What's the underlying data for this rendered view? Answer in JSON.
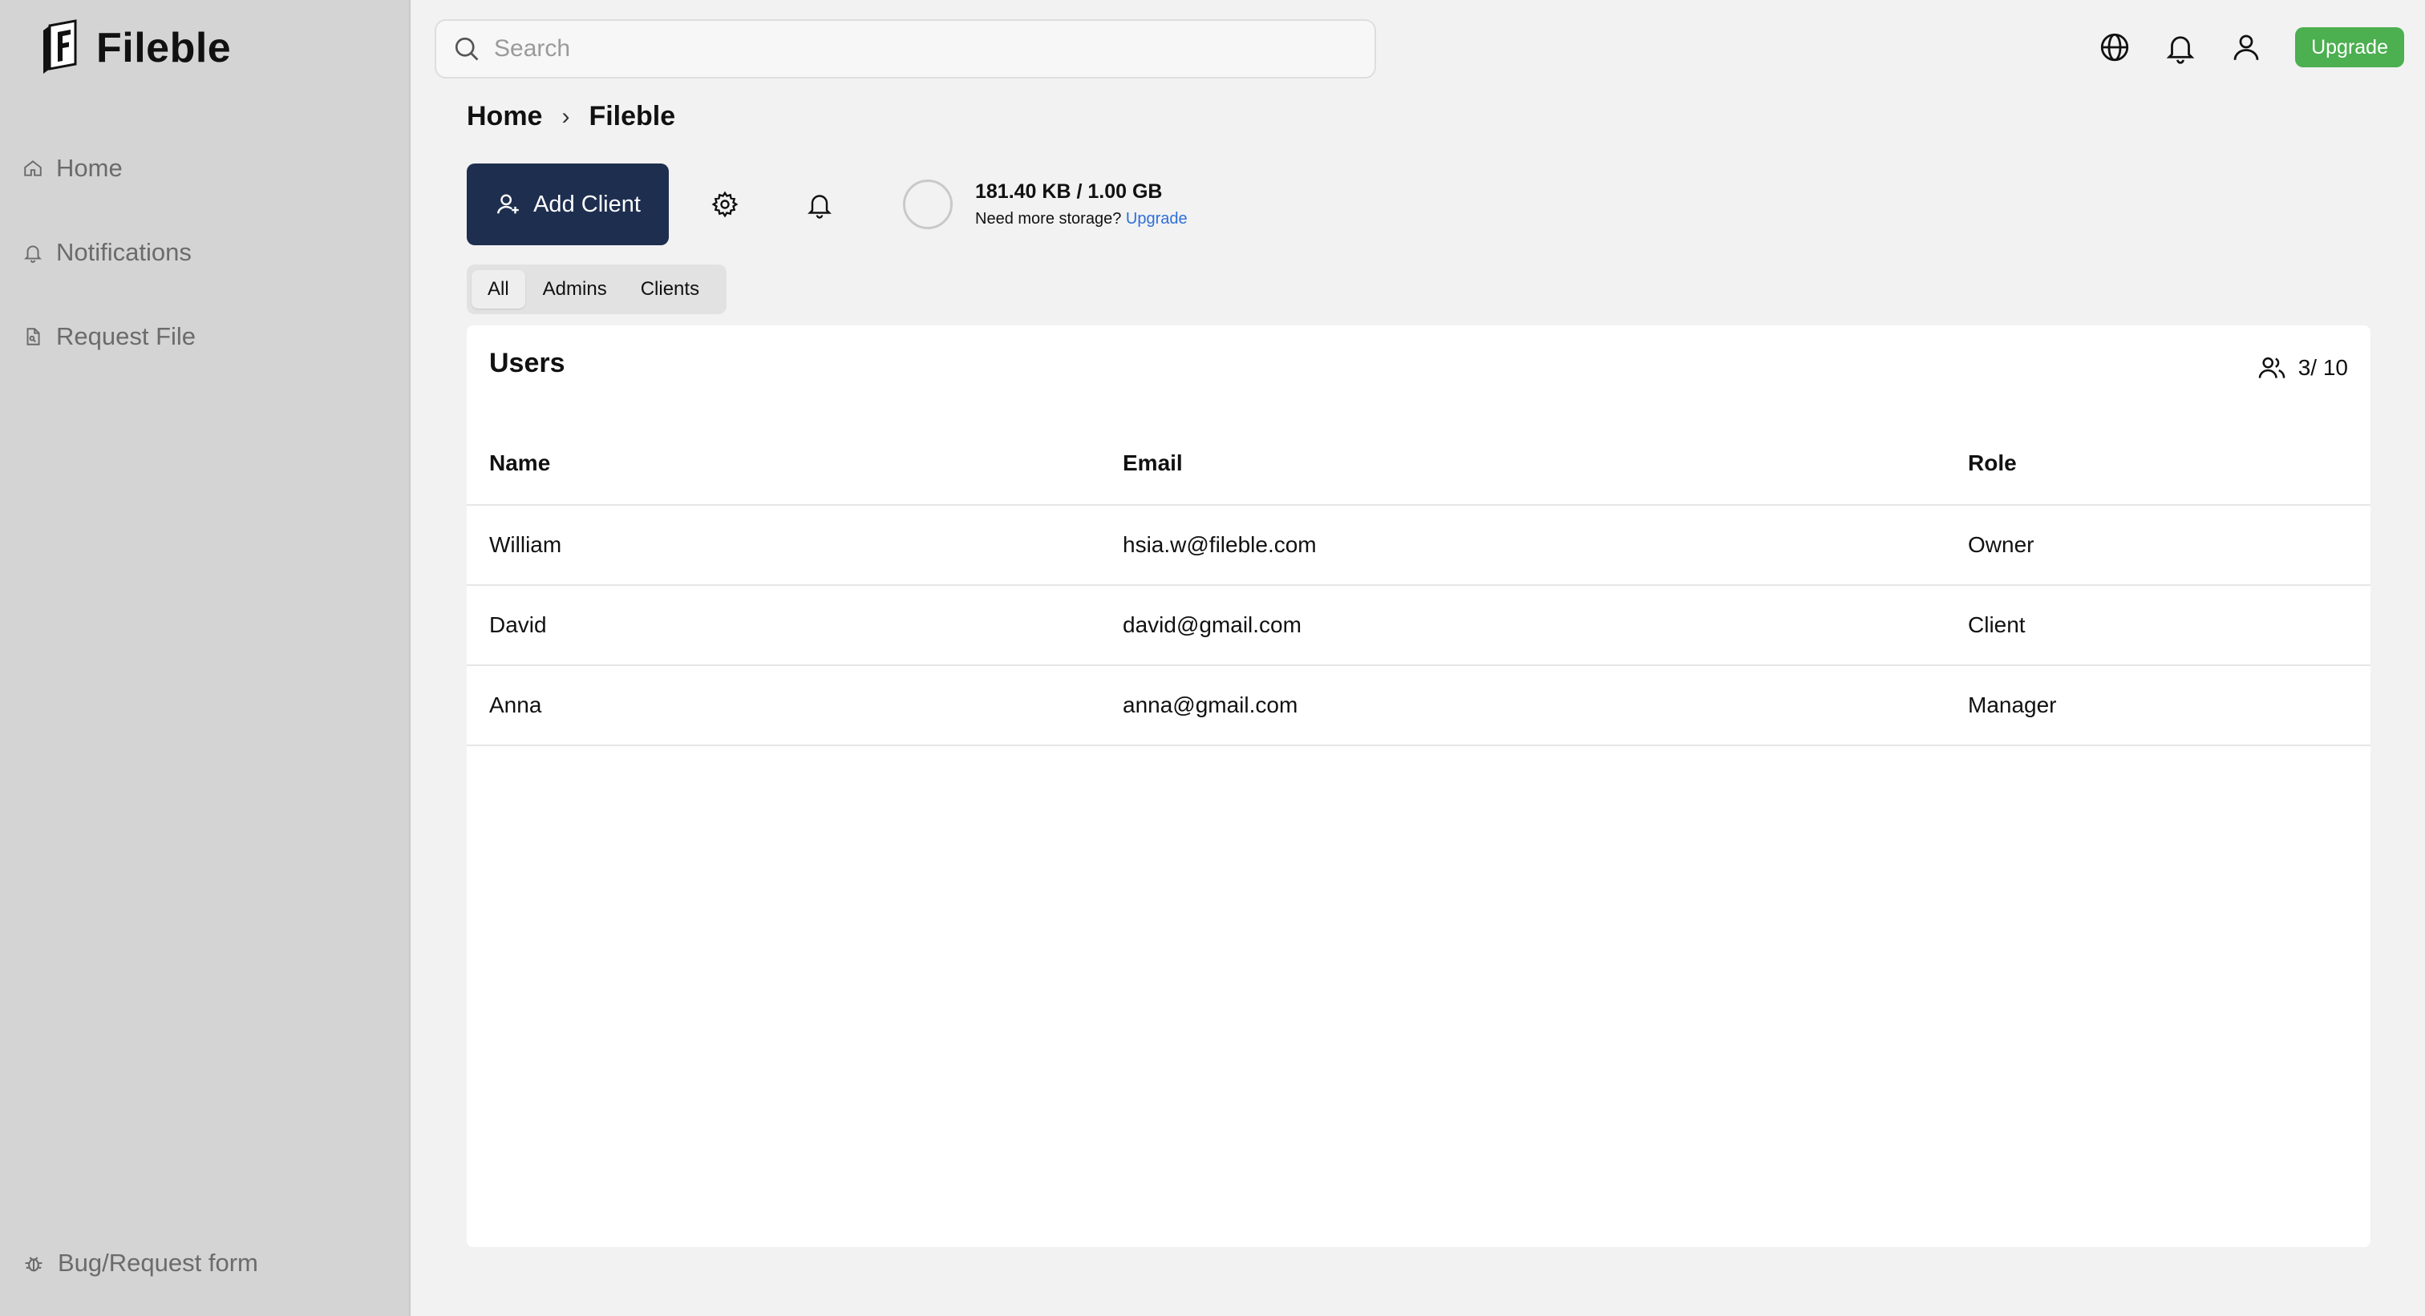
{
  "app": {
    "name": "Fileble"
  },
  "sidebar": {
    "items": [
      {
        "label": "Home",
        "icon": "home-icon"
      },
      {
        "label": "Notifications",
        "icon": "bell-icon"
      },
      {
        "label": "Request File",
        "icon": "file-request-icon"
      }
    ],
    "bottom_item": {
      "label": "Bug/Request form",
      "icon": "bug-icon"
    }
  },
  "topbar": {
    "search_placeholder": "Search",
    "upgrade_label": "Upgrade",
    "colors": {
      "upgrade": "#4caf50"
    }
  },
  "breadcrumb": {
    "root": "Home",
    "separator": "›",
    "current": "Fileble"
  },
  "toolbar": {
    "add_client_label": "Add Client",
    "storage_used": "181.40 KB / 1.00 GB",
    "storage_prompt": "Need more storage?",
    "storage_upgrade_link": "Upgrade",
    "colors": {
      "primary": "#1e2e4f",
      "link": "#2f6fd6"
    }
  },
  "tabs": [
    {
      "label": "All",
      "active": true
    },
    {
      "label": "Admins",
      "active": false
    },
    {
      "label": "Clients",
      "active": false
    }
  ],
  "users_card": {
    "title": "Users",
    "count": "3/ 10",
    "columns": {
      "name": "Name",
      "email": "Email",
      "role": "Role"
    },
    "rows": [
      {
        "name": "William",
        "email": "hsia.w@fileble.com",
        "role": "Owner"
      },
      {
        "name": "David",
        "email": "david@gmail.com",
        "role": "Client"
      },
      {
        "name": "Anna",
        "email": "anna@gmail.com",
        "role": "Manager"
      }
    ]
  }
}
